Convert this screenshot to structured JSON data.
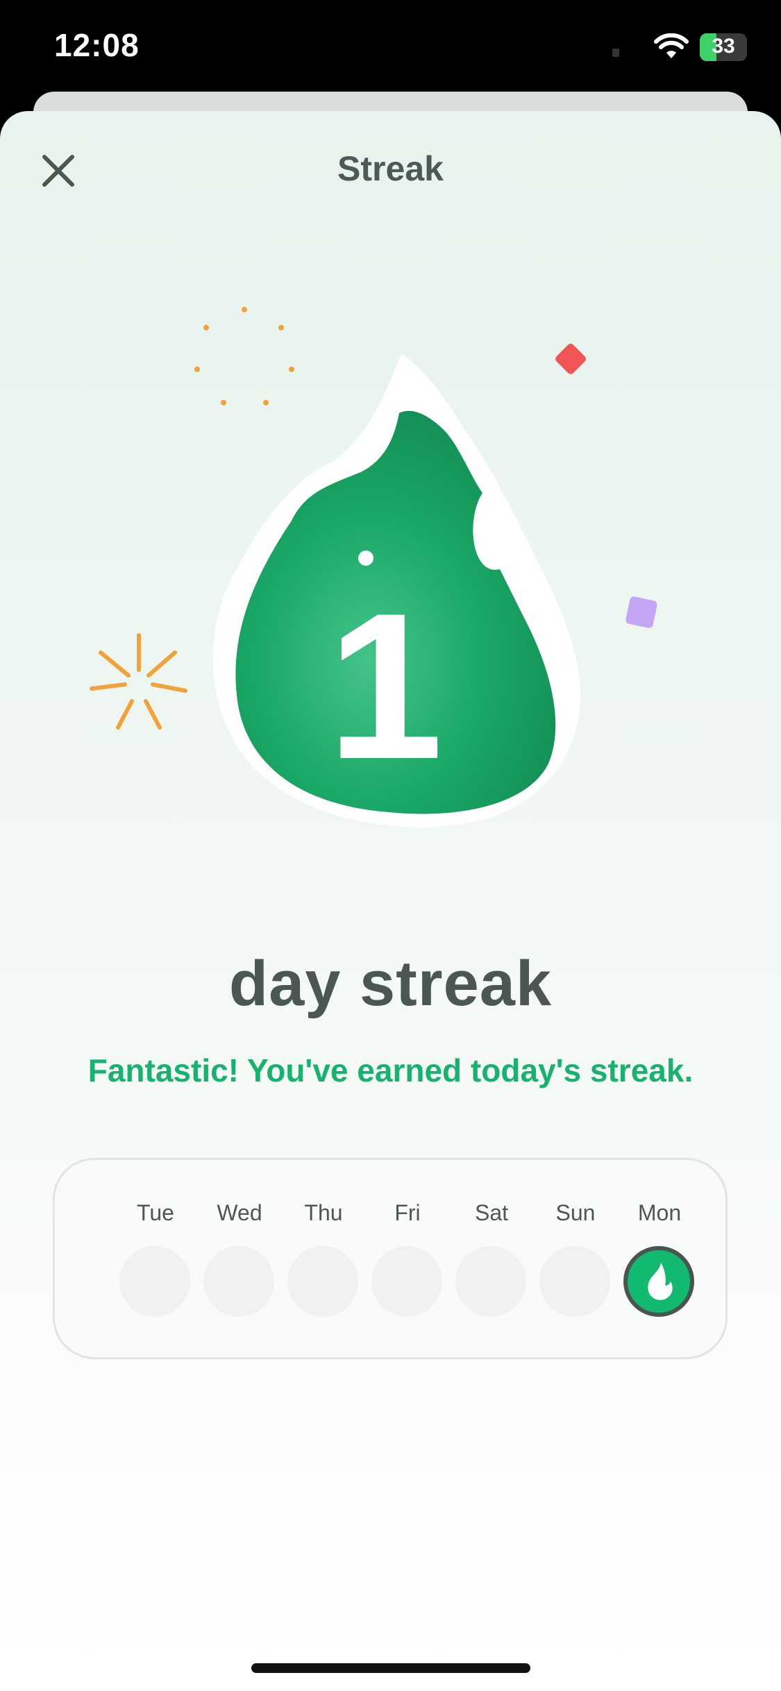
{
  "status_bar": {
    "time": "12:08",
    "battery_level": "33"
  },
  "header": {
    "title": "Streak",
    "close_icon": "close-icon"
  },
  "badge": {
    "number": "1",
    "icon": "flame-icon"
  },
  "streak_label": "day streak",
  "message": "Fantastic! You've earned today's streak.",
  "week": {
    "days": [
      {
        "label": "Tue",
        "done": false
      },
      {
        "label": "Wed",
        "done": false
      },
      {
        "label": "Thu",
        "done": false
      },
      {
        "label": "Fri",
        "done": false
      },
      {
        "label": "Sat",
        "done": false
      },
      {
        "label": "Sun",
        "done": false
      },
      {
        "label": "Mon",
        "done": true
      }
    ]
  },
  "colors": {
    "accent": "#12BA70",
    "text_dark": "#4B5752",
    "confetti_red": "#F05454",
    "confetti_purple": "#C3A4F5",
    "sparkle_orange": "#F2A23A"
  }
}
